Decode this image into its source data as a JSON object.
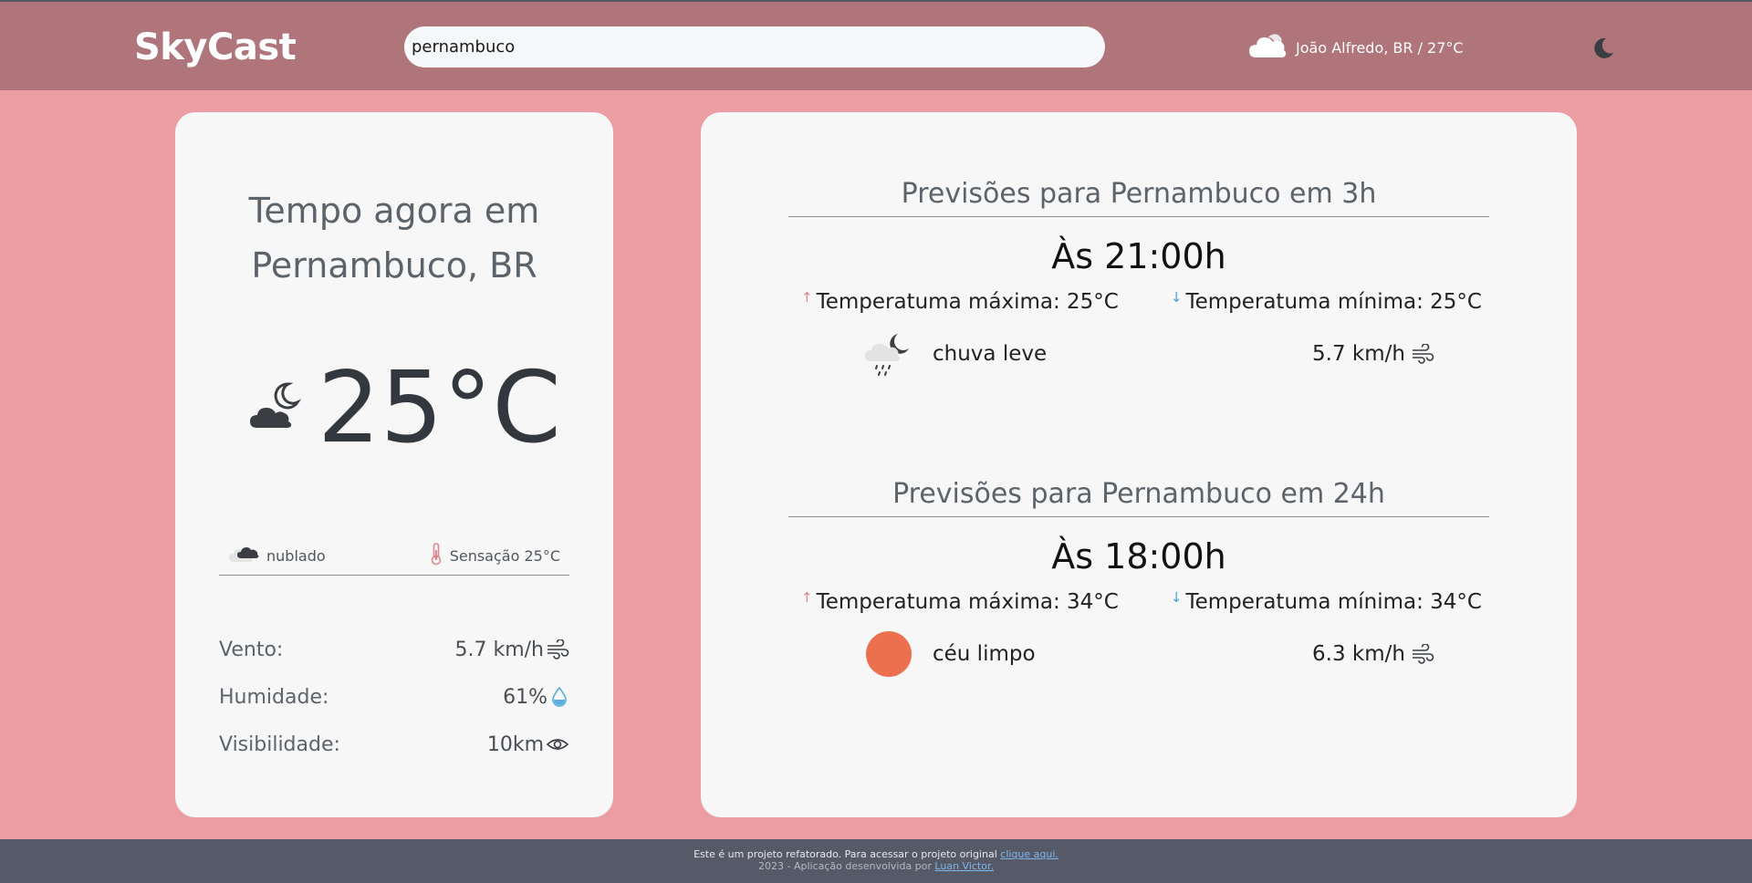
{
  "header": {
    "logo": "SkyCast",
    "search_value": "pernambuco",
    "current_location": "João Alfredo, BR / 27°C",
    "weather_icon": "cloud-icon",
    "theme_icon": "moon-icon"
  },
  "now": {
    "title_line1": "Tempo agora em",
    "title_line2": "Pernambuco, BR",
    "icon": "cloud-moon-icon",
    "temperature": "25°C",
    "condition": "nublado",
    "feels_like": "Sensação 25°C",
    "stats": [
      {
        "label": "Vento:",
        "value": "5.7 km/h",
        "icon": "wind-icon"
      },
      {
        "label": "Humidade:",
        "value": "61%",
        "icon": "droplet-icon"
      },
      {
        "label": "Visibilidade:",
        "value": "10km",
        "icon": "eye-icon"
      }
    ]
  },
  "forecasts": [
    {
      "title": "Previsões para Pernambuco em 3h",
      "time": "Às 21:00h",
      "max": "Temperatuma máxima: 25°C",
      "min": "Temperatuma mínima: 25°C",
      "condition": "chuva leve",
      "icon": "rain-cloud-moon-icon",
      "wind": "5.7 km/h"
    },
    {
      "title": "Previsões para Pernambuco em 24h",
      "time": "Às 18:00h",
      "max": "Temperatuma máxima: 34°C",
      "min": "Temperatuma mínima: 34°C",
      "condition": "céu limpo",
      "icon": "sun-icon",
      "wind": "6.3 km/h"
    }
  ],
  "footer": {
    "line1": "Este é um projeto refatorado. Para acessar o projeto original",
    "line1_link": "clique aqui.",
    "line2": "2023 - Aplicação desenvolvida por",
    "line2_link": "Luan Victor."
  },
  "colors": {
    "page_bg": "#eb9da2",
    "header_bg": "#b0757b",
    "card_bg": "#f7f7f7",
    "footer_bg": "#555968",
    "sun": "#ec6f4e"
  }
}
